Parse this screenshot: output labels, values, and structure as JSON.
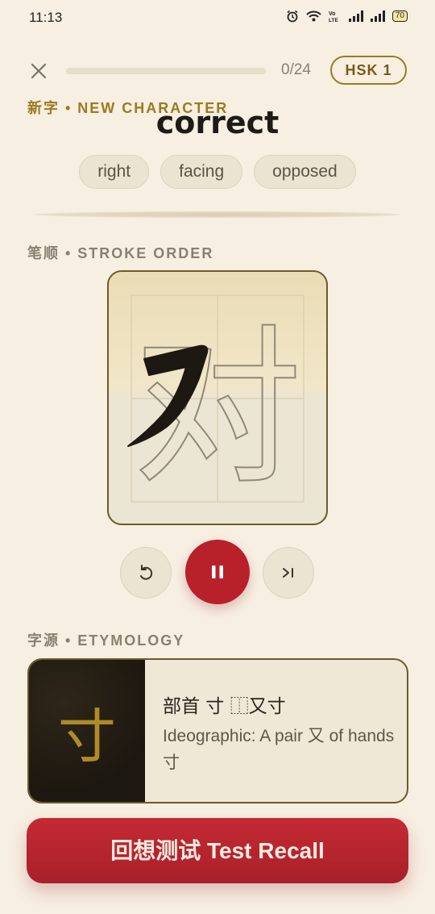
{
  "status_bar": {
    "time": "11:13",
    "battery": "70"
  },
  "top_bar": {
    "progress_text": "0/24",
    "progress_fraction": 0.0,
    "level_badge": "HSK 1"
  },
  "new_character": {
    "label": "新字 • NEW CHARACTER",
    "word": "correct",
    "meanings": [
      "right",
      "facing",
      "opposed"
    ]
  },
  "stroke_order": {
    "label": "笔顺 • STROKE ORDER",
    "character": "对"
  },
  "etymology": {
    "label": "字源 • ETYMOLOGY",
    "radical_glyph": "寸",
    "title": "部首 寸 ⿰又寸",
    "description": "Ideographic: A pair 又 of hands 寸"
  },
  "cta": {
    "label": "回想测试 Test Recall"
  },
  "colors": {
    "accent": "#b8202a",
    "gold": "#9c7a20",
    "background": "#f7efe2"
  }
}
